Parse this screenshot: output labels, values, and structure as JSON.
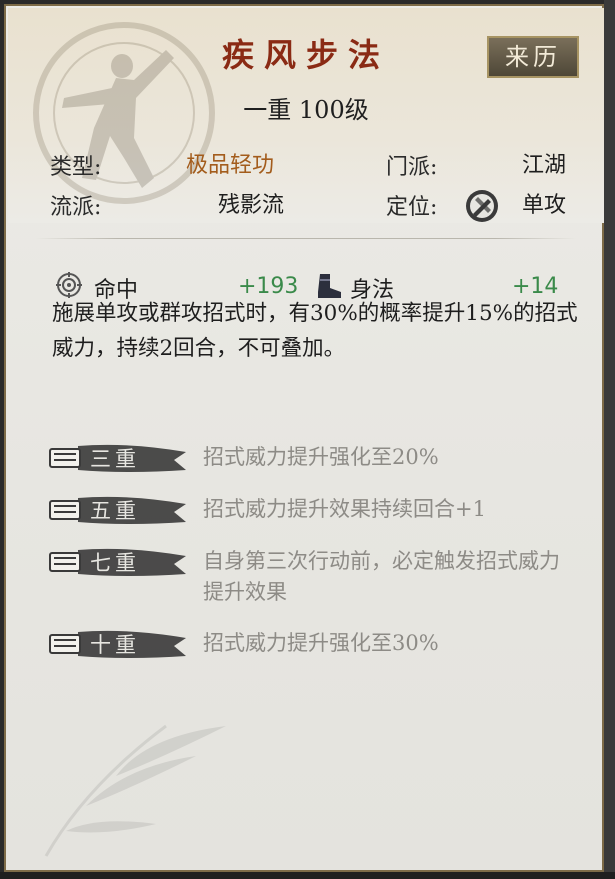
{
  "skill": {
    "name": "疾风步法",
    "history_label": "来历",
    "level_text": "一重 100级"
  },
  "info": {
    "type_label": "类型:",
    "type_value": "极品轻功",
    "sect_label": "门派:",
    "sect_value": "江湖",
    "school_label": "流派:",
    "school_value": "残影流",
    "role_label": "定位:",
    "role_value": "单攻",
    "role_icon": "single-attack-icon"
  },
  "stats": [
    {
      "icon": "target-icon",
      "label": "命中",
      "value": "+193"
    },
    {
      "icon": "boot-icon",
      "label": "身法",
      "value": "+14"
    }
  ],
  "description": "施展单攻或群攻招式时，有30%的概率提升15%的招式威力，持续2回合，不可叠加。",
  "tiers": [
    {
      "label": "三重",
      "text": "招式威力提升强化至20%"
    },
    {
      "label": "五重",
      "text": "招式威力提升效果持续回合+1"
    },
    {
      "label": "七重",
      "text": "自身第三次行动前，必定触发招式威力提升效果"
    },
    {
      "label": "十重",
      "text": "招式威力提升强化至30%"
    }
  ],
  "colors": {
    "title": "#8a2a14",
    "type_value": "#a35c1c",
    "stat_value": "#3a8a4a",
    "tier_text": "#8d8b86"
  }
}
